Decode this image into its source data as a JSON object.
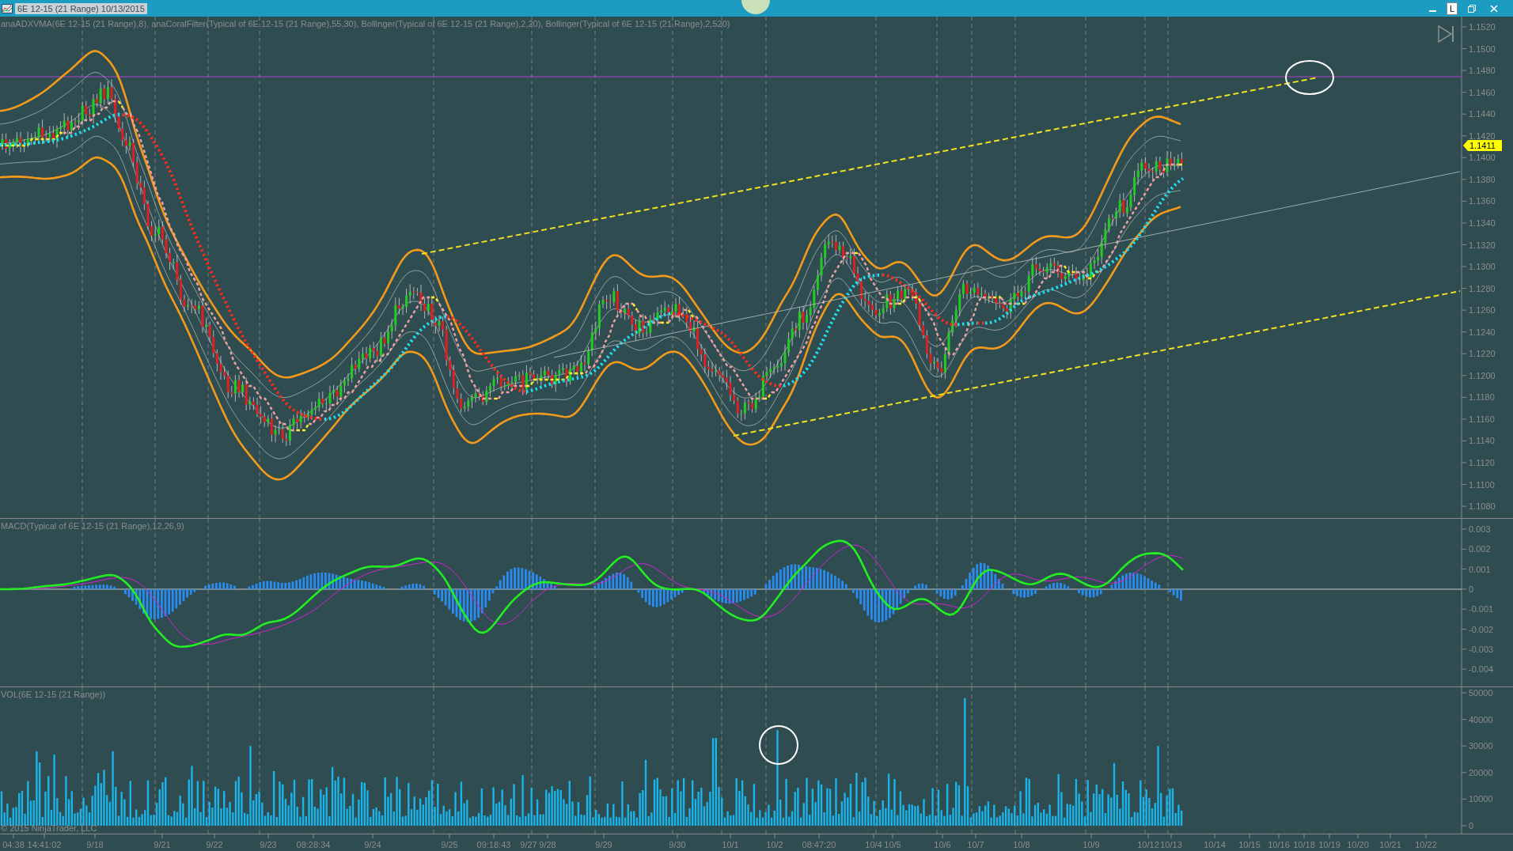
{
  "window": {
    "title": "6E 12-15 (21 Range)  10/13/2015",
    "button_label": "L"
  },
  "panes": [
    {
      "kind": "price",
      "label": "anaADXVMA(6E 12-15 (21 Range),8), anaCoralFilter(Typical of 6E 12-15 (21 Range),55,30), Bollinger(Typical of 6E 12-15 (21 Range),2,20), Bollinger(Typical of 6E 12-15 (21 Range),2,520)",
      "ticks": [
        "1.1520",
        "1.1500",
        "1.1480",
        "1.1460",
        "1.1440",
        "1.1420",
        "1.1400",
        "1.1380",
        "1.1360",
        "1.1340",
        "1.1320",
        "1.1300",
        "1.1280",
        "1.1260",
        "1.1240",
        "1.1220",
        "1.1200",
        "1.1180",
        "1.1160",
        "1.1140",
        "1.1120",
        "1.1100",
        "1.1080"
      ],
      "last_price": "1.1411"
    },
    {
      "kind": "macd",
      "label": "MACD(Typical of 6E 12-15 (21 Range),12,26,9)",
      "ticks": [
        "0.003",
        "0.002",
        "0.001",
        "0",
        "-0.001",
        "-0.002",
        "-0.003",
        "-0.004"
      ]
    },
    {
      "kind": "volume",
      "label": "VOL(6E 12-15 (21 Range))",
      "ticks": [
        "50000",
        "40000",
        "30000",
        "20000",
        "10000",
        "0"
      ],
      "copyright": "© 2015 NinjaTrader, LLC"
    }
  ],
  "time_axis": [
    "04:38",
    "14:41:02",
    "9/18",
    "9/21",
    "9/22",
    "9/23",
    "08:28:34",
    "9/24",
    "9/25",
    "09:18:43",
    "9/27",
    "9/28",
    "9/29",
    "9/30",
    "10/1",
    "10/2",
    "08:47:20",
    "10/4",
    "10/5",
    "10/6",
    "10/7",
    "10/8",
    "10/9",
    "10/12",
    "10/13",
    "10/14",
    "10/15",
    "10/16",
    "10/18",
    "10/19",
    "10/20",
    "10/21",
    "10/22"
  ]
}
